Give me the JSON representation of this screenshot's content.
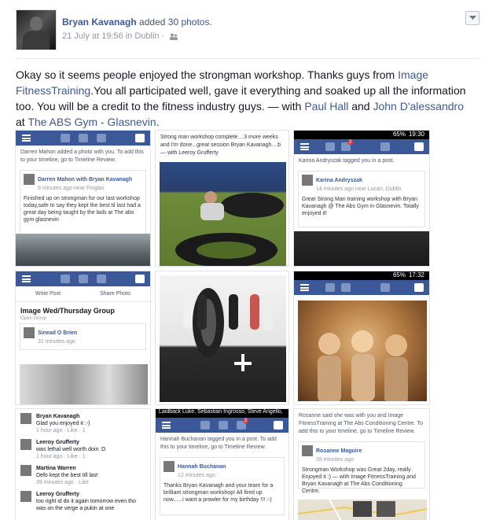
{
  "header": {
    "author": "Bryan Kavanagh",
    "action_text": "added",
    "photo_count_link": "30 photos",
    "period": ".",
    "timestamp": "21 July at 19:56",
    "in_text": "in",
    "location": "Dublin",
    "dot": "·"
  },
  "post": {
    "t1": "Okay so it seems people enjoyed the strongman workshop. Thanks guys from ",
    "link_image_fitness": "Image FitnessTraining",
    "t2": ".You all participated well, gave it everything and soaked up all the information too. You will be a credit to the fitness industry guys. — with ",
    "link_paul": "Paul Hall",
    "t3": " and ",
    "link_john": "John D'alessandro",
    "t4": " at ",
    "link_abs": "The ABS Gym - Glasnevin",
    "t5": "."
  },
  "tiles": {
    "t1": {
      "note": "Darren Mahon added a photo with you. To add this to your timeline, go to Timeline Review.",
      "name": "Darren Mahon with Bryan Kavanagh",
      "time": "8 minutes ago near Finglas",
      "text": "Finished up on strongman for our last workshop today,safe to say they kept the best til last had a great day being taught by the lads at The abs gym glasnevin"
    },
    "t2": {
      "caption": "Strong man workshop complete....3 more weeks and I'm done...great session Bryan Kavanagh....b — with Leeroy Grufferty"
    },
    "t3": {
      "time": "19:30",
      "battery": "65%",
      "badge": "2",
      "note": "Karina Andryszak tagged you in a post.",
      "name": "Karina Andryszak",
      "time2": "14 minutes ago near Lucan, Dublin",
      "text": "Great Strong Man training workshop with Bryan Kavanagh @ The Abs Gym in Glasnevin. Totally enjoyed it!"
    },
    "t4": {
      "write": "Write Post",
      "share": "Share Photo",
      "group": "Image Wed/Thursday Group",
      "group_sub": "Open Group",
      "name": "Sinead O Brien",
      "time": "31 minutes ago"
    },
    "t6": {
      "time": "17:32",
      "battery": "65%"
    },
    "t7": {
      "c1_name": "Bryan Kavanagh",
      "c1_text": "Glad you enjoyed it :-)",
      "c1_meta": "1 hour ago · Like · 1",
      "c2_name": "Leeroy Grufferty",
      "c2_text": "was lethal well worth doin :D",
      "c2_meta": "1 hour ago · Like · 1",
      "c3_name": "Martina Warren",
      "c3_text": "Defo kept the best till last",
      "c3_meta": "39 minutes ago · Like",
      "c4_name": "Leeroy Grufferty",
      "c4_text": "too right id do it again tomorrow even tho was on the verge a pukin at one"
    },
    "t8": {
      "top": "Laidback Luke, Sebastian Ingrosso, Steve Angello,",
      "badge": "2",
      "note": "Hannah Buchanan tagged you in a post. To add this to your timeline, go to Timeline Review.",
      "name": "Hannah Buchanan",
      "time": "12 minutes ago",
      "text": "Thanks Bryan Kavanagh and your team for a brilliant strongman workshop! All fired up now......i want a prowler for my birthday !!! :-)"
    },
    "t9": {
      "note": "Rosanne said she was with you and Image FitnessTraining at The Abs Conditioning Centre. To add this to your timeline, go to Timeline Review.",
      "name": "Rosanne Maguire",
      "time": "28 minutes ago",
      "text": "Strongman Workshop was Great 2day, really Enjoyed it :) — with Image FitnessTraining and Bryan Kavanagh at The Abs Conditioning Centre."
    }
  }
}
